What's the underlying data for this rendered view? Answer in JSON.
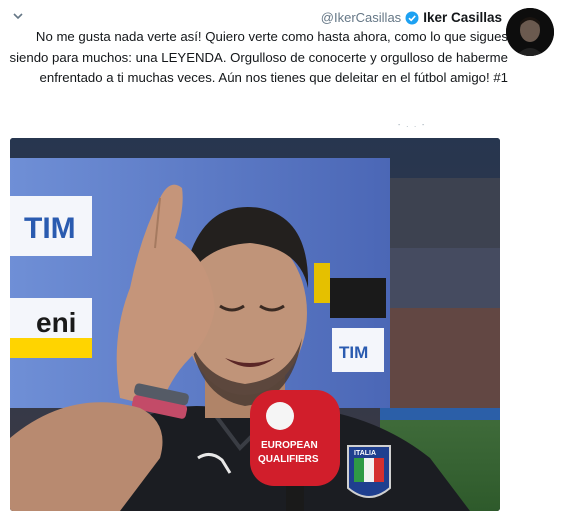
{
  "tweet": {
    "handle": "@IkerCasillas",
    "display_name": "Iker Casillas",
    "verified_icon": "verified-badge-icon",
    "menu_icon": "chevron-down-icon",
    "text": "No me gusta nada verte así! Quiero verte como hasta ahora, como lo que sigues siendo para muchos: una LEYENDA. Orgulloso de conocerte y orgulloso de haberme enfrentado a ti muchas veces. Aún nos tienes que deleitar en el fútbol amigo! #1",
    "accent_color": "#1da1f2"
  },
  "photo": {
    "boards": {
      "tim_left": "TIM",
      "eni": "eni",
      "tim_right": "TIM"
    },
    "mic_text_1": "EUROPEAN",
    "mic_text_2": "QUALIFIERS",
    "badge_text": "ITALIA"
  }
}
